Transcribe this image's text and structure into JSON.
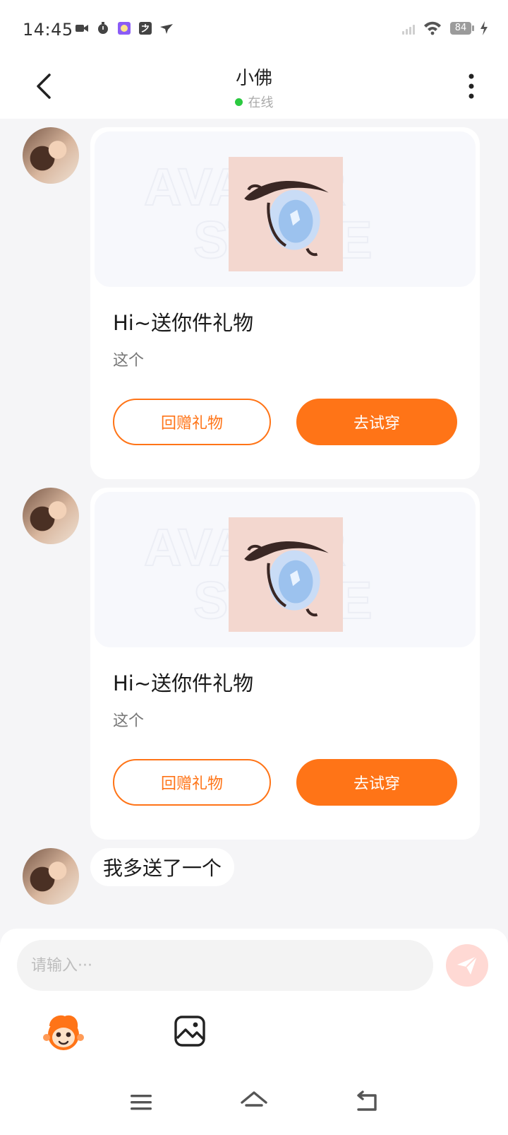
{
  "status_bar": {
    "time": "14:45",
    "battery": "84",
    "icons": [
      "video-icon",
      "timer-icon",
      "app-icon",
      "alipay-icon",
      "send-app-icon",
      "signal-icon",
      "wifi-icon",
      "battery-icon",
      "charging-icon"
    ]
  },
  "header": {
    "title": "小佛",
    "status": "在线",
    "status_color": "#2bc940"
  },
  "messages": [
    {
      "type": "gift",
      "title": "Hi~送你件礼物",
      "subtitle": "这个",
      "return_gift_label": "回赠礼物",
      "try_on_label": "去试穿"
    },
    {
      "type": "gift",
      "title": "Hi~送你件礼物",
      "subtitle": "这个",
      "return_gift_label": "回赠礼物",
      "try_on_label": "去试穿"
    },
    {
      "type": "text",
      "text": "我多送了一个"
    }
  ],
  "composer": {
    "placeholder": "请输入···"
  },
  "colors": {
    "accent": "#ff7417",
    "background": "#f5f5f7",
    "send_button": "#ffd9d4"
  },
  "nav": [
    "menu-icon",
    "home-icon",
    "back-icon"
  ]
}
